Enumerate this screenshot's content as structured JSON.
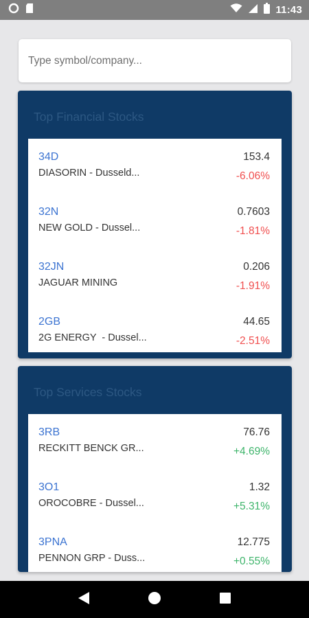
{
  "status_bar": {
    "time": "11:43"
  },
  "search": {
    "placeholder": "Type symbol/company..."
  },
  "financial": {
    "title": "Top Financial Stocks",
    "items": [
      {
        "symbol": "34D",
        "name": "DIASORIN - Dusseld...",
        "price": "153.4",
        "change": "-6.06%"
      },
      {
        "symbol": "32N",
        "name": "NEW GOLD - Dussel...",
        "price": "0.7603",
        "change": "-1.81%"
      },
      {
        "symbol": "32JN",
        "name": "JAGUAR MINING",
        "price": "0.206",
        "change": "-1.91%"
      },
      {
        "symbol": "2GB",
        "name": "2G ENERGY  - Dussel...",
        "price": "44.65",
        "change": "-2.51%"
      }
    ]
  },
  "services": {
    "title": "Top Services Stocks",
    "items": [
      {
        "symbol": "3RB",
        "name": "RECKITT BENCK GR...",
        "price": "76.76",
        "change": "+4.69%"
      },
      {
        "symbol": "3O1",
        "name": "OROCOBRE - Dussel...",
        "price": "1.32",
        "change": "+5.31%"
      },
      {
        "symbol": "3PNA",
        "name": "PENNON GRP - Duss...",
        "price": "12.775",
        "change": "+0.55%"
      }
    ]
  },
  "colors": {
    "panel_bg": "#0f3a66",
    "symbol": "#3b73d1",
    "negative": "#f04e4e",
    "positive": "#3db46a"
  },
  "icons": {
    "status_left": [
      "circle-status-icon",
      "sd-card-icon"
    ],
    "status_right": [
      "wifi-icon",
      "signal-icon",
      "battery-icon"
    ],
    "nav": [
      "back-icon",
      "home-icon",
      "recents-icon"
    ]
  }
}
